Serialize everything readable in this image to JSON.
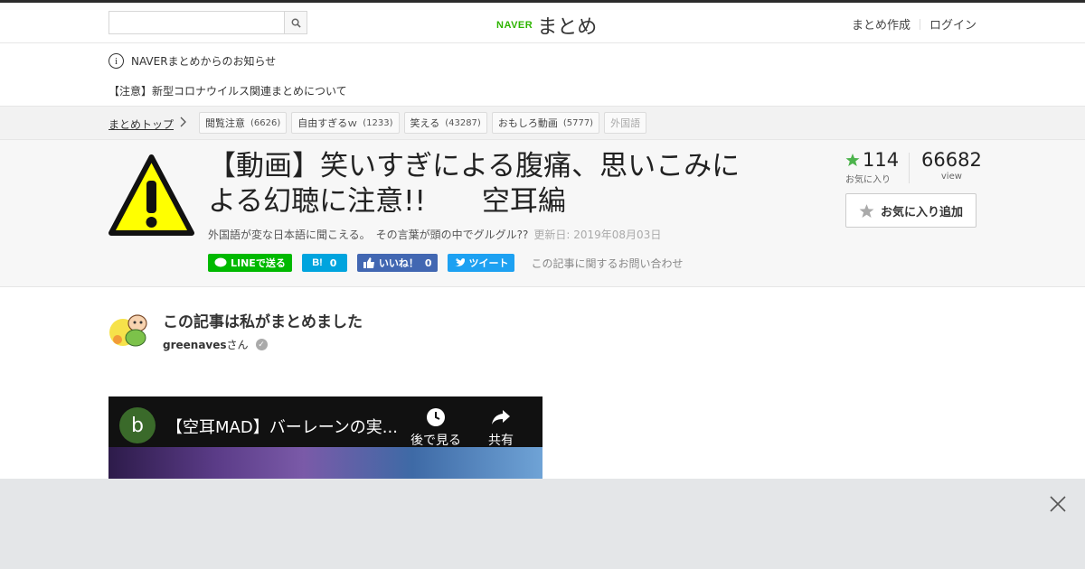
{
  "header": {
    "search_placeholder": "",
    "logo_naver": "NAVER",
    "logo_matome": "まとめ",
    "create_link": "まとめ作成",
    "login_link": "ログイン"
  },
  "notice": {
    "heading": "NAVERまとめからのお知らせ",
    "item": "【注意】新型コロナウイルス関連まとめについて"
  },
  "breadcrumb": {
    "top": "まとめトップ",
    "tags": [
      {
        "label": "閲覧注意",
        "count": "(6626)"
      },
      {
        "label": "自由すぎるｗ",
        "count": "(1233)"
      },
      {
        "label": "笑える",
        "count": "(43287)"
      },
      {
        "label": "おもしろ動画",
        "count": "(5777)"
      },
      {
        "label": "外国語",
        "count": ""
      }
    ]
  },
  "article": {
    "title": "【動画】笑いすぎによる腹痛、思いこみによる幻聴に注意!!　　空耳編",
    "description": "外国語が変な日本語に聞こえる。　その言葉が頭の中でグルグル??",
    "updated": "更新日: 2019年08月03日",
    "share": {
      "line": "LINEで送る",
      "hatena_count": "0",
      "fb_label": "いいね！",
      "fb_count": "0",
      "tweet": "ツイート"
    },
    "contact": "この記事に関するお問い合わせ",
    "fav_count": "114",
    "fav_label": "お気に入り",
    "view_count": "66682",
    "view_label": "view",
    "fav_button": "お気に入り追加"
  },
  "author": {
    "heading": "この記事は私がまとめました",
    "name": "greenaves",
    "suffix": "さん"
  },
  "video": {
    "channel_initial": "b",
    "title": "【空耳MAD】バーレーンの実...",
    "watch_later": "後で見る",
    "share": "共有"
  },
  "colors": {
    "naver_green": "#2db400",
    "line_green": "#00b900",
    "hatena_blue": "#00a4de",
    "facebook_blue": "#4267b2",
    "twitter_blue": "#1da1f2",
    "star_green": "#4cb34c"
  },
  "icons": [
    "search-icon",
    "info-icon",
    "chevron-right-icon",
    "warning-icon",
    "star-icon",
    "verified-icon",
    "clock-icon",
    "share-icon",
    "close-icon"
  ]
}
